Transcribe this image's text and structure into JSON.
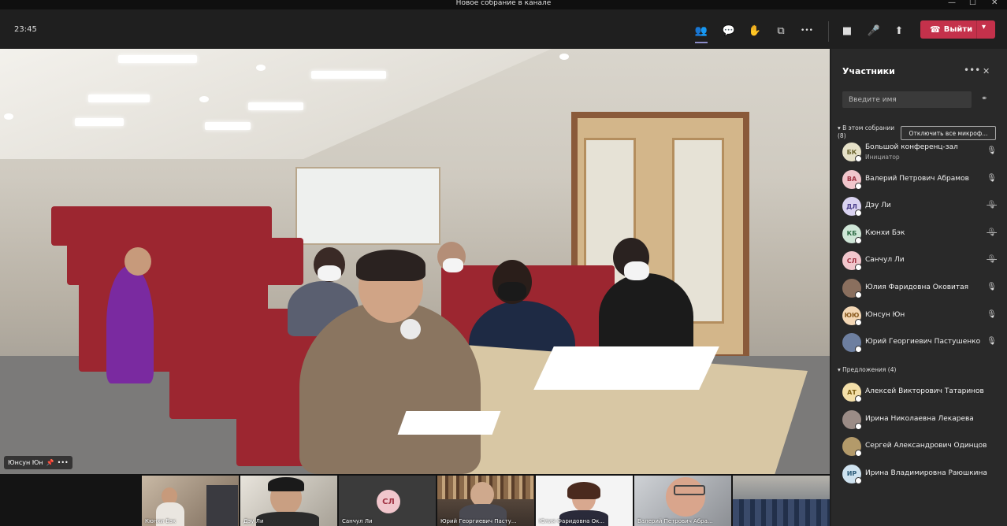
{
  "window": {
    "title": "Новое собрание в канале",
    "minimize": "—",
    "maximize": "☐",
    "close": "✕"
  },
  "toolbar": {
    "time": "23:45",
    "leave_label": "Выйти",
    "icons": {
      "participants": "👥",
      "chat": "💬",
      "reactions": "✋",
      "rooms": "⧉",
      "more": "•••",
      "camera": "■",
      "mic": "🎤",
      "share": "⬆"
    }
  },
  "video": {
    "speaker_name": "Юнсун Юн",
    "more": "•••"
  },
  "strip": [
    {
      "name": "Кюнхи Бэк"
    },
    {
      "name": "Дэу Ли"
    },
    {
      "name": "Санчул Ли",
      "initials": "СЛ"
    },
    {
      "name": "Юрий Георгиевич Пасту..."
    },
    {
      "name": "Юлия Фаридовна Ок..."
    },
    {
      "name": "Валерий Петрович Абра..."
    },
    {
      "name": ""
    }
  ],
  "panel": {
    "title": "Участники",
    "more": "•••",
    "close": "✕",
    "search_placeholder": "Введите имя",
    "in_meeting_label": "В этом собрании",
    "in_meeting_count": "(8)",
    "mute_all": "Отключить все микроф...",
    "in_meeting": [
      {
        "initials": "БК",
        "name": "Большой конференц-зал",
        "role": "Инициатор",
        "mic": "on",
        "bg": "#e6e1c8",
        "fg": "#6b6530"
      },
      {
        "initials": "ВА",
        "name": "Валерий Петрович Абрамов",
        "mic": "on",
        "bg": "#f1c6cc",
        "fg": "#a13343"
      },
      {
        "initials": "ДЛ",
        "name": "Дэу Ли",
        "mic": "off",
        "bg": "#d9d2f0",
        "fg": "#4b3f8c"
      },
      {
        "initials": "КБ",
        "name": "Кюнхи Бэк",
        "mic": "off",
        "bg": "#cfe6d7",
        "fg": "#2d6b45"
      },
      {
        "initials": "СЛ",
        "name": "Санчул Ли",
        "mic": "off",
        "bg": "#f1c6cc",
        "fg": "#a13343"
      },
      {
        "initials": "",
        "name": "Юлия Фаридовна Оковитая",
        "mic": "on",
        "bg": "#8a6f5e",
        "fg": "#fff"
      },
      {
        "initials": "ЮЮ",
        "name": "Юнсун Юн",
        "mic": "on",
        "bg": "#f3d7b5",
        "fg": "#8a5a1f"
      },
      {
        "initials": "",
        "name": "Юрий Георгиевич Пастушенко",
        "mic": "on",
        "bg": "#6d7fa0",
        "fg": "#fff"
      }
    ],
    "suggestions_label": "Предложения (4)",
    "suggestions": [
      {
        "initials": "АТ",
        "name": "Алексей Викторович Татаринов",
        "bg": "#f3dfa9",
        "fg": "#7a5d12"
      },
      {
        "initials": "",
        "name": "Ирина Николаевна Лекарева",
        "bg": "#9b8c86",
        "fg": "#fff"
      },
      {
        "initials": "",
        "name": "Сергей Александрович Одинцов",
        "bg": "#b39a6a",
        "fg": "#fff"
      },
      {
        "initials": "ИР",
        "name": "Ирина Владимировна Раюшкина",
        "bg": "#cfe3f0",
        "fg": "#2d5d7a"
      }
    ]
  }
}
